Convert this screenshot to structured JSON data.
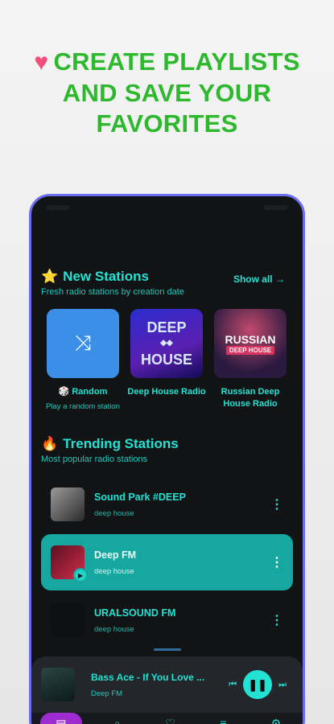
{
  "promo": {
    "line1": "CREATE PLAYLISTS",
    "line2": "AND SAVE YOUR",
    "line3": "FAVORITES"
  },
  "new_stations": {
    "title": "New Stations",
    "subtitle": "Fresh radio stations by creation date",
    "show_all": "Show all",
    "cards": [
      {
        "title": "🎲 Random",
        "sub": "Play a random station"
      },
      {
        "title": "Deep House Radio",
        "art_line1": "DEEP",
        "art_line2": "HOUSE"
      },
      {
        "title": "Russian Deep House Radio",
        "art_line1": "RUSSIAN",
        "art_line2": "DEEP HOUSE"
      }
    ]
  },
  "trending": {
    "title": "Trending Stations",
    "subtitle": "Most popular radio stations",
    "rows": [
      {
        "name": "Sound Park #DEEP",
        "genre": "deep house"
      },
      {
        "name": "Deep FM",
        "genre": "deep house"
      },
      {
        "name": "URALSOUND FM",
        "genre": "deep house"
      }
    ]
  },
  "player": {
    "title": "Bass Ace - If You Love ...",
    "station": "Deep FM"
  },
  "colors": {
    "accent": "#22e2d4",
    "promo_green": "#2db82d",
    "active_row": "#15a7a0",
    "nav_active": "#9e2bd0"
  }
}
